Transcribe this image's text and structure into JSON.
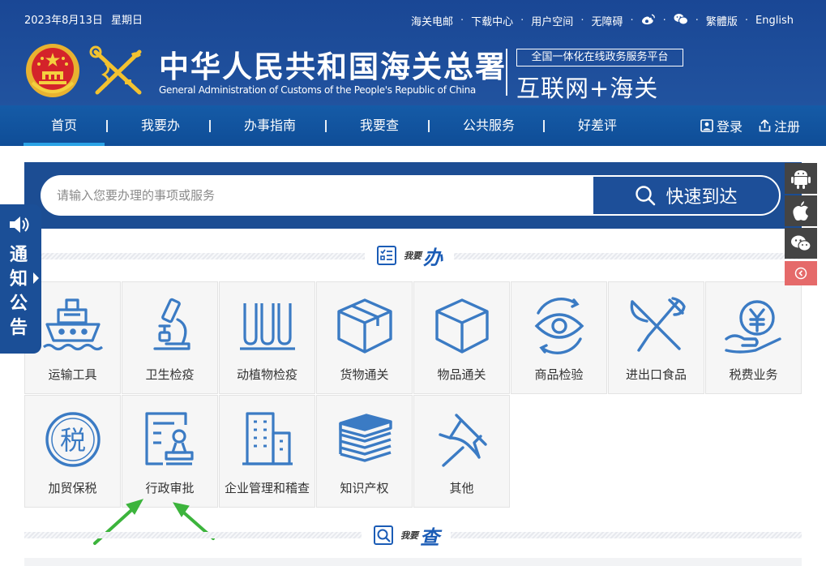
{
  "topbar": {
    "date": "2023年8月13日",
    "weekday": "星期日",
    "links": [
      "海关电邮",
      "下载中心",
      "用户空间",
      "无障碍",
      "繁體版",
      "English"
    ]
  },
  "header": {
    "title_cn": "中华人民共和国海关总署",
    "title_en": "General Administration of Customs of the People's Republic of China",
    "platform_tag": "全国一体化在线政务服务平台",
    "platform_name": "互联网+海关"
  },
  "nav": {
    "items": [
      "首页",
      "我要办",
      "办事指南",
      "我要查",
      "公共服务",
      "好差评"
    ],
    "active": "首页",
    "login": "登录",
    "register": "注册"
  },
  "search": {
    "placeholder": "请输入您要办理的事项或服务",
    "button": "快速到达"
  },
  "sections": {
    "ban_small": "我要",
    "ban_big": "办",
    "cha_small": "我要",
    "cha_big": "查"
  },
  "services": [
    {
      "label": "运输工具",
      "icon": "ship-icon"
    },
    {
      "label": "卫生检疫",
      "icon": "microscope-icon"
    },
    {
      "label": "动植物检疫",
      "icon": "test-tubes-icon"
    },
    {
      "label": "货物通关",
      "icon": "open-box-icon"
    },
    {
      "label": "物品通关",
      "icon": "cube-icon"
    },
    {
      "label": "商品检验",
      "icon": "eye-scan-icon"
    },
    {
      "label": "进出口食品",
      "icon": "knife-fork-icon"
    },
    {
      "label": "税费业务",
      "icon": "yen-hand-icon"
    },
    {
      "label": "加贸保税",
      "icon": "tax-circle-icon"
    },
    {
      "label": "行政审批",
      "icon": "approval-stamp-icon"
    },
    {
      "label": "企业管理和稽查",
      "icon": "building-icon"
    },
    {
      "label": "知识产权",
      "icon": "books-icon"
    },
    {
      "label": "其他",
      "icon": "pin-icon"
    }
  ],
  "notice": {
    "label": "通知公告"
  },
  "colors": {
    "header_blue": "#1b4a98",
    "nav_blue": "#13549f",
    "icon_blue": "#3b7bc4",
    "annotation_green": "#3cb43c"
  }
}
